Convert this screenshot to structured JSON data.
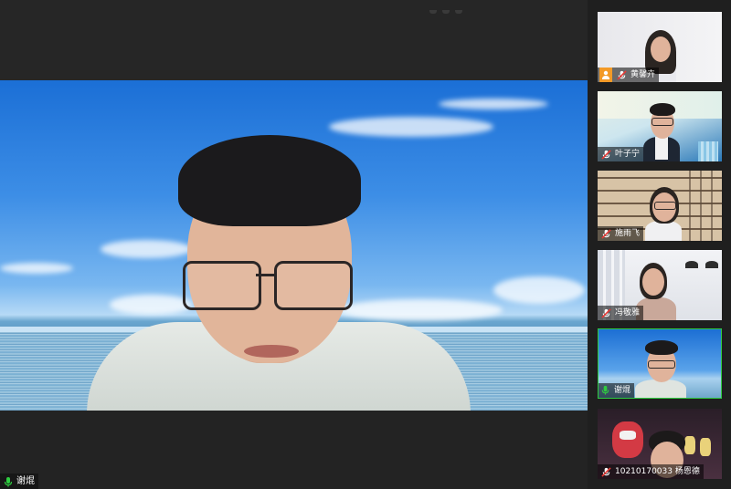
{
  "main_speaker": {
    "name": "谢焜",
    "mic": "active"
  },
  "participants": [
    {
      "name": "黄馨卉",
      "status": "host",
      "mic": "muted"
    },
    {
      "name": "叶子宁",
      "status": "participant",
      "mic": "muted"
    },
    {
      "name": "施雨飞",
      "status": "participant",
      "mic": "muted"
    },
    {
      "name": "冯敬雅",
      "status": "participant",
      "mic": "muted"
    },
    {
      "name": "谢焜",
      "status": "speaking",
      "mic": "active"
    },
    {
      "name": "10210170033 杨恩德",
      "status": "participant",
      "mic": "muted"
    }
  ],
  "colors": {
    "active_mic": "#2ecc40",
    "muted_mic": "#e53935",
    "host_badge": "#f39a27",
    "active_border": "#2ecc40"
  }
}
